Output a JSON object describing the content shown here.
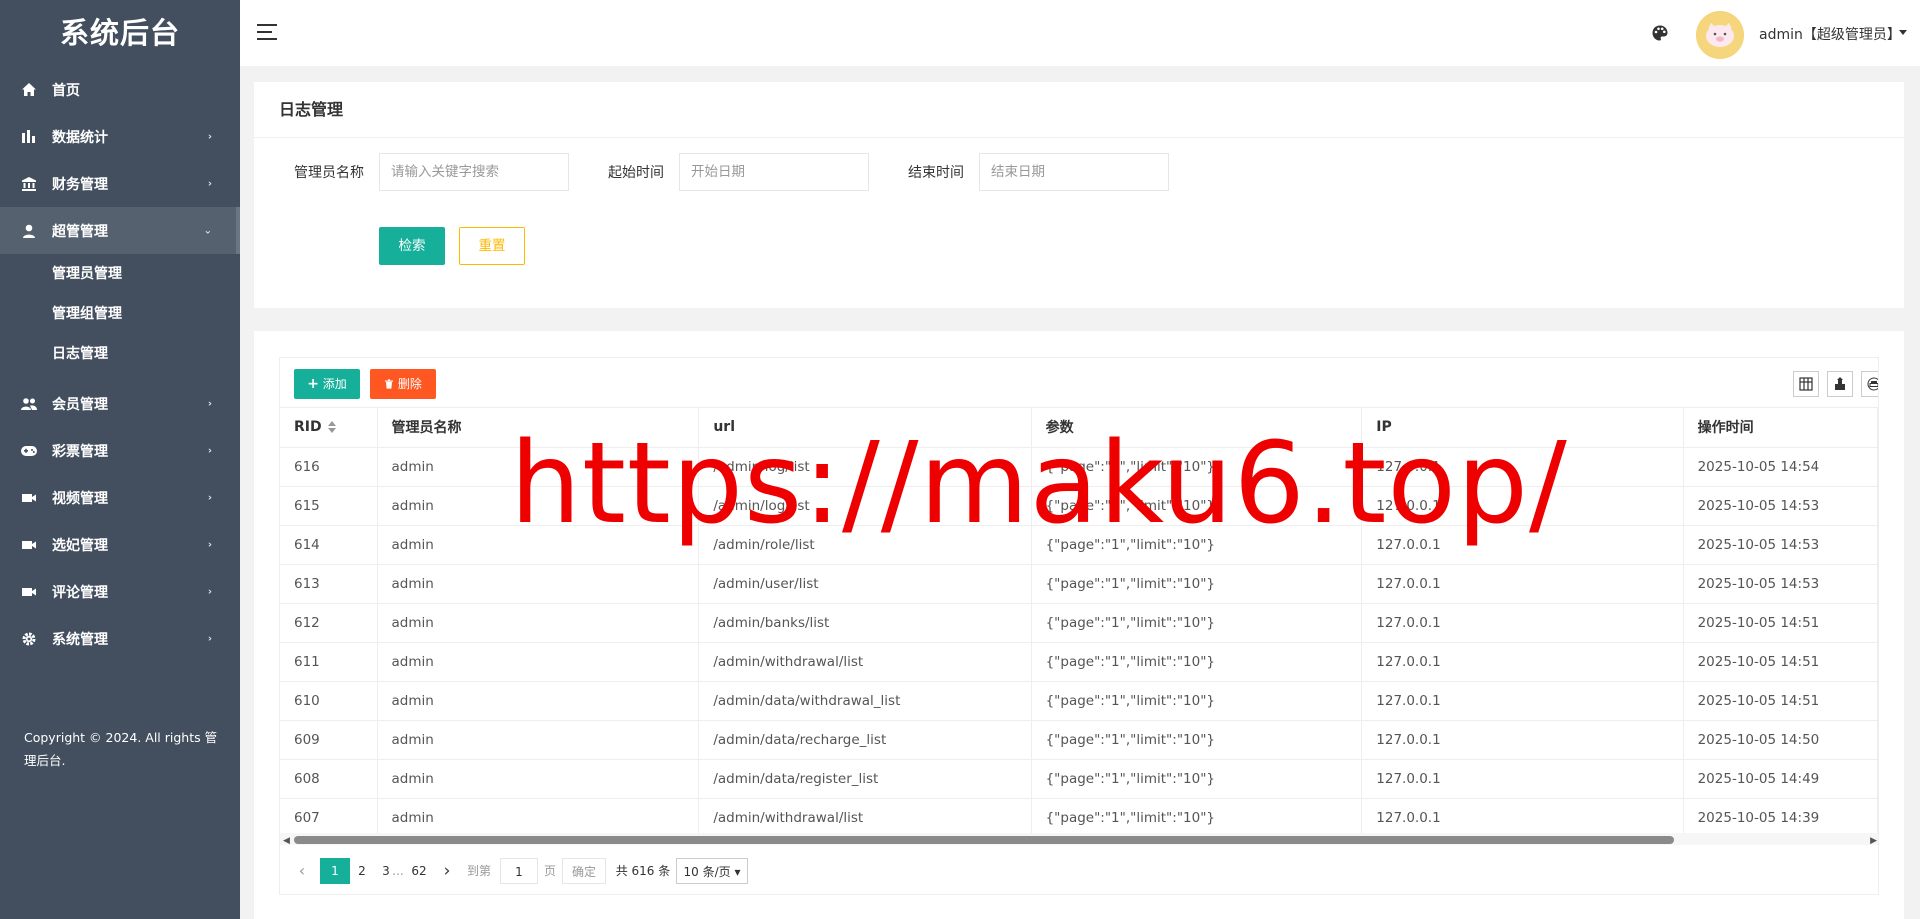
{
  "sidebar": {
    "brand": "系统后台",
    "items": [
      {
        "label": "首页",
        "icon": "home-icon",
        "has_arrow": false
      },
      {
        "label": "数据统计",
        "icon": "bar-chart-icon",
        "has_arrow": true
      },
      {
        "label": "财务管理",
        "icon": "bank-icon",
        "has_arrow": true
      },
      {
        "label": "超管管理",
        "icon": "user-icon",
        "has_arrow": true,
        "active": true
      }
    ],
    "submenu": [
      "管理员管理",
      "管理组管理",
      "日志管理"
    ],
    "items_after": [
      {
        "label": "会员管理",
        "icon": "users-icon"
      },
      {
        "label": "彩票管理",
        "icon": "gamepad-icon"
      },
      {
        "label": "视频管理",
        "icon": "video-icon"
      },
      {
        "label": "选妃管理",
        "icon": "video-icon"
      },
      {
        "label": "评论管理",
        "icon": "video-icon"
      },
      {
        "label": "系统管理",
        "icon": "gear-icon"
      }
    ],
    "copyright": "Copyright © 2024. All rights 管理后台."
  },
  "header": {
    "user": "admin【超级管理员】"
  },
  "search": {
    "title": "日志管理",
    "admin_label": "管理员名称",
    "admin_placeholder": "请输入关键字搜索",
    "start_label": "起始时间",
    "start_placeholder": "开始日期",
    "end_label": "结束时间",
    "end_placeholder": "结束日期",
    "search_btn": "检索",
    "reset_btn": "重置"
  },
  "table": {
    "add_btn": "添加",
    "delete_btn": "删除",
    "columns": [
      "RID",
      "管理员名称",
      "url",
      "参数",
      "IP",
      "操作时间"
    ],
    "rows": [
      [
        "616",
        "admin",
        "/admin/log/list",
        "{\"page\":\"1\",\"limit\":\"10\"}",
        "127.0.0.1",
        "2025-10-05 14:54"
      ],
      [
        "615",
        "admin",
        "/admin/log/list",
        "{\"page\":\"1\",\"limit\":\"10\"}",
        "127.0.0.1",
        "2025-10-05 14:53"
      ],
      [
        "614",
        "admin",
        "/admin/role/list",
        "{\"page\":\"1\",\"limit\":\"10\"}",
        "127.0.0.1",
        "2025-10-05 14:53"
      ],
      [
        "613",
        "admin",
        "/admin/user/list",
        "{\"page\":\"1\",\"limit\":\"10\"}",
        "127.0.0.1",
        "2025-10-05 14:53"
      ],
      [
        "612",
        "admin",
        "/admin/banks/list",
        "{\"page\":\"1\",\"limit\":\"10\"}",
        "127.0.0.1",
        "2025-10-05 14:51"
      ],
      [
        "611",
        "admin",
        "/admin/withdrawal/list",
        "{\"page\":\"1\",\"limit\":\"10\"}",
        "127.0.0.1",
        "2025-10-05 14:51"
      ],
      [
        "610",
        "admin",
        "/admin/data/withdrawal_list",
        "{\"page\":\"1\",\"limit\":\"10\"}",
        "127.0.0.1",
        "2025-10-05 14:51"
      ],
      [
        "609",
        "admin",
        "/admin/data/recharge_list",
        "{\"page\":\"1\",\"limit\":\"10\"}",
        "127.0.0.1",
        "2025-10-05 14:50"
      ],
      [
        "608",
        "admin",
        "/admin/data/register_list",
        "{\"page\":\"1\",\"limit\":\"10\"}",
        "127.0.0.1",
        "2025-10-05 14:49"
      ],
      [
        "607",
        "admin",
        "/admin/withdrawal/list",
        "{\"page\":\"1\",\"limit\":\"10\"}",
        "127.0.0.1",
        "2025-10-05 14:39"
      ]
    ]
  },
  "pager": {
    "current": "1",
    "p2": "2",
    "p3": "3",
    "ellipsis": "...",
    "last": "62",
    "goto_label": "到第",
    "goto_value": "1",
    "page_unit": "页",
    "confirm": "确定",
    "total": "共 616 条",
    "per_page": "10 条/页"
  },
  "watermark": "https://maku6.top/",
  "colors": {
    "sidebar": "#434f5f",
    "primary": "#16b09a",
    "danger": "#ff5722",
    "warning": "#ffb800"
  }
}
